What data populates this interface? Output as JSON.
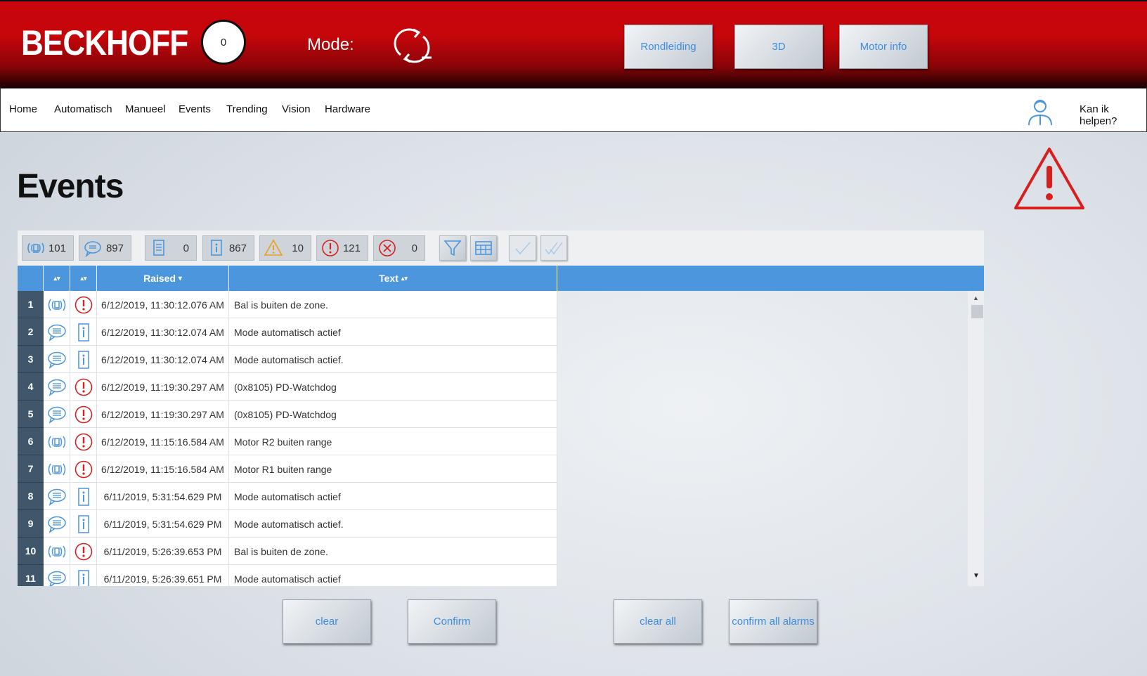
{
  "header": {
    "logo": "BECKHOFF",
    "counter": "0",
    "mode_label": "Mode:",
    "buttons": [
      "Rondleiding",
      "3D",
      "Motor info"
    ]
  },
  "nav": {
    "items": [
      "Home",
      "Automatisch",
      "Manueel",
      "Events",
      "Trending",
      "Vision",
      "Hardware"
    ],
    "help": "Kan ik helpen?"
  },
  "page": {
    "title": "Events"
  },
  "toolbar": {
    "counts": {
      "alarms": "101",
      "messages": "897",
      "verbose": "0",
      "info": "867",
      "warning": "10",
      "error": "121",
      "critical": "0"
    }
  },
  "table": {
    "headers": {
      "raised": "Raised",
      "raised_sort": "▾",
      "text": "Text",
      "text_sort": "▴▾",
      "sort1": "▴▾",
      "sort2": "▴▾"
    },
    "rows": [
      {
        "num": "1",
        "type": "alarm",
        "severity": "error",
        "raised": "6/12/2019, 11:30:12.076 AM",
        "text": "Bal is buiten de zone."
      },
      {
        "num": "2",
        "type": "message",
        "severity": "info",
        "raised": "6/12/2019, 11:30:12.074 AM",
        "text": "Mode automatisch actief"
      },
      {
        "num": "3",
        "type": "message",
        "severity": "info",
        "raised": "6/12/2019, 11:30:12.074 AM",
        "text": "Mode automatisch actief."
      },
      {
        "num": "4",
        "type": "message",
        "severity": "error",
        "raised": "6/12/2019, 11:19:30.297 AM",
        "text": "(0x8105) PD-Watchdog"
      },
      {
        "num": "5",
        "type": "message",
        "severity": "error",
        "raised": "6/12/2019, 11:19:30.297 AM",
        "text": "(0x8105) PD-Watchdog"
      },
      {
        "num": "6",
        "type": "alarm",
        "severity": "error",
        "raised": "6/12/2019, 11:15:16.584 AM",
        "text": "Motor R2 buiten range"
      },
      {
        "num": "7",
        "type": "alarm",
        "severity": "error",
        "raised": "6/12/2019, 11:15:16.584 AM",
        "text": "Motor R1 buiten range"
      },
      {
        "num": "8",
        "type": "message",
        "severity": "info",
        "raised": "6/11/2019, 5:31:54.629 PM",
        "text": "Mode automatisch actief"
      },
      {
        "num": "9",
        "type": "message",
        "severity": "info",
        "raised": "6/11/2019, 5:31:54.629 PM",
        "text": "Mode automatisch actief."
      },
      {
        "num": "10",
        "type": "alarm",
        "severity": "error",
        "raised": "6/11/2019, 5:26:39.653 PM",
        "text": "Bal is buiten de zone."
      },
      {
        "num": "11",
        "type": "message",
        "severity": "info",
        "raised": "6/11/2019, 5:26:39.651 PM",
        "text": "Mode automatisch actief"
      }
    ]
  },
  "actions": {
    "clear": "clear",
    "confirm": "Confirm",
    "clear_all": "clear all",
    "confirm_all": "confirm all alarms"
  },
  "colors": {
    "header_red": "#c8070c",
    "accent_blue": "#4b96dc",
    "error_red": "#d62020",
    "warning_orange": "#e8a21c"
  }
}
